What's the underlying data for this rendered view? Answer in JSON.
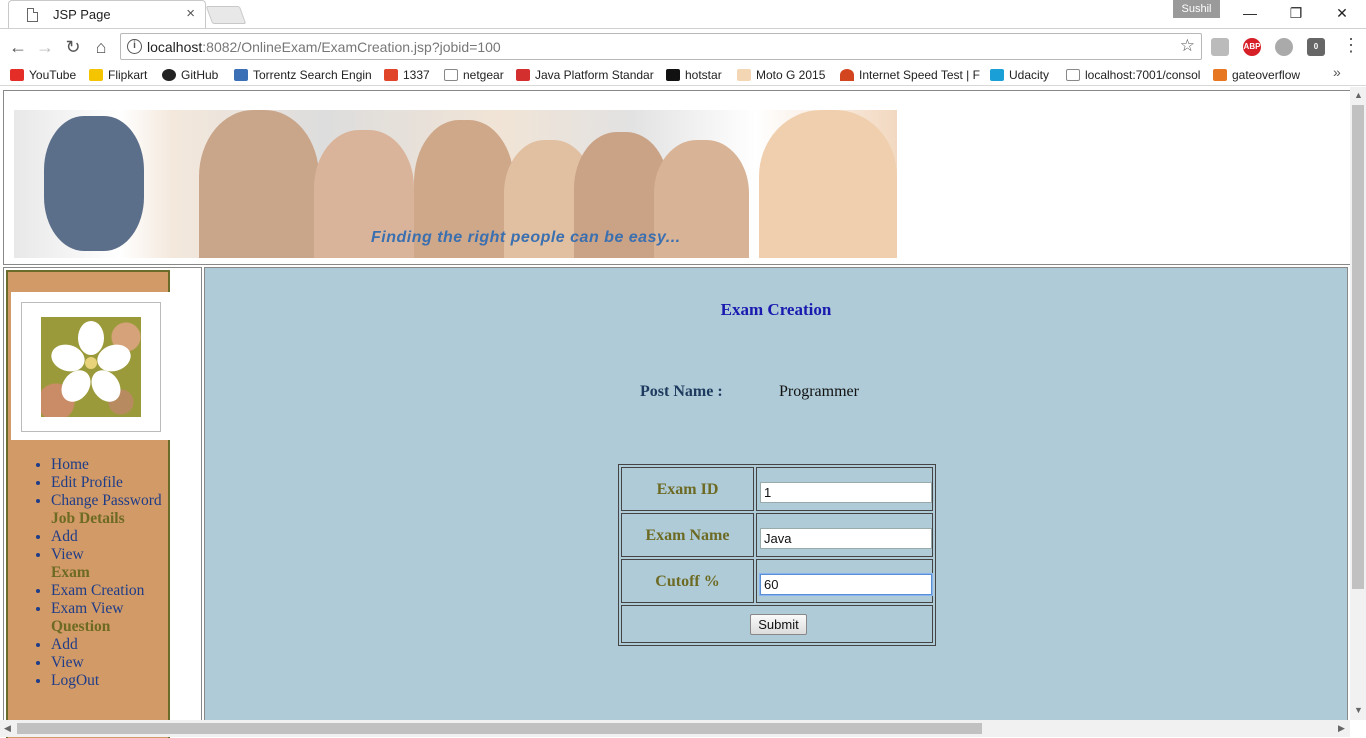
{
  "browser": {
    "tab_title": "JSP Page",
    "tab_close": "×",
    "profile_name": "Sushil",
    "url_host": "localhost",
    "url_rest": ":8082/OnlineExam/ExamCreation.jsp?jobid=100",
    "window_controls": {
      "minimize": "—",
      "restore": "❐",
      "close": "✕"
    },
    "ext_abp": "ABP",
    "ext_badge": "0"
  },
  "bookmarks": [
    {
      "label": "YouTube",
      "color": "#e52d27"
    },
    {
      "label": "Flipkart",
      "color": "#f5c400"
    },
    {
      "label": "GitHub",
      "color": "#222222"
    },
    {
      "label": "Torrentz Search Engin",
      "color": "#3b6fb6"
    },
    {
      "label": "1337",
      "color": "#e0452a"
    },
    {
      "label": "netgear",
      "color": "#888888"
    },
    {
      "label": "Java Platform Standar",
      "color": "#d32f2f"
    },
    {
      "label": "hotstar",
      "color": "#111111"
    },
    {
      "label": "Moto G 2015",
      "color": "#e6a35a"
    },
    {
      "label": "Internet Speed Test | F",
      "color": "#d2451e"
    },
    {
      "label": "Udacity",
      "color": "#1aa0d6"
    },
    {
      "label": "localhost:7001/consol",
      "color": "#888888"
    },
    {
      "label": "gateoverflow",
      "color": "#e87722"
    }
  ],
  "banner": {
    "tagline": "Finding the right people can be easy..."
  },
  "sidebar": {
    "menu": [
      {
        "type": "link",
        "label": "Home"
      },
      {
        "type": "link",
        "label": "Edit Profile"
      },
      {
        "type": "link",
        "label": "Change Password"
      },
      {
        "type": "head",
        "label": "Job Details"
      },
      {
        "type": "link",
        "label": "Add"
      },
      {
        "type": "link",
        "label": "View"
      },
      {
        "type": "head",
        "label": "Exam"
      },
      {
        "type": "link",
        "label": "Exam Creation"
      },
      {
        "type": "link",
        "label": "Exam View"
      },
      {
        "type": "head",
        "label": "Question"
      },
      {
        "type": "link",
        "label": "Add"
      },
      {
        "type": "link",
        "label": "View"
      },
      {
        "type": "link",
        "label": "LogOut"
      }
    ]
  },
  "main": {
    "title": "Exam Creation",
    "post_label": "Post Name :",
    "post_value": "Programmer",
    "form": {
      "exam_id_label": "Exam ID",
      "exam_id_value": "1",
      "exam_name_label": "Exam Name",
      "exam_name_value": "Java",
      "cutoff_label": "Cutoff %",
      "cutoff_value": "60",
      "submit_label": "Submit"
    }
  }
}
